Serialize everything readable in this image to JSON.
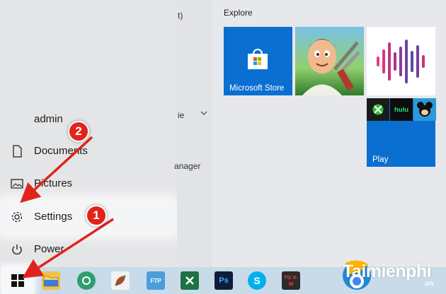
{
  "start_menu": {
    "user": "admin",
    "items": [
      {
        "label": "Documents",
        "icon": "document-icon"
      },
      {
        "label": "Pictures",
        "icon": "pictures-icon"
      },
      {
        "label": "Settings",
        "icon": "gear-icon"
      },
      {
        "label": "Power",
        "icon": "power-icon"
      }
    ],
    "middle_fragments": [
      "t)",
      "ie",
      "anager"
    ]
  },
  "tiles": {
    "group_title": "Explore",
    "store_label": "Microsoft Store",
    "play_label": "Play",
    "mini_labels": [
      "",
      "hulu",
      ""
    ]
  },
  "annotations": {
    "step1": "1",
    "step2": "2",
    "arrow_color": "#e0241b"
  },
  "taskbar": {
    "icons": [
      "file-explorer-icon",
      "app-green-icon",
      "app-leaf-icon",
      "app-ftp-icon",
      "app-excel-icon",
      "photoshop-icon",
      "skype-icon",
      "tgxm-icon",
      "chrome-icon"
    ],
    "labels": [
      "",
      "",
      "",
      "FTP",
      "",
      "Ps",
      "S",
      "TG X-M",
      ""
    ]
  },
  "watermark": {
    "text": "Taimienphi",
    "suffix": ".vn"
  }
}
